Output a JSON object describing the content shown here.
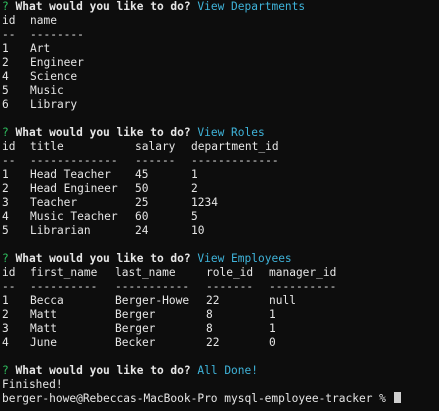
{
  "prompt_mark": "?",
  "question": "What would you like to do?",
  "departments": {
    "answer": "View Departments",
    "headers": [
      "id",
      "name"
    ],
    "rules": [
      "--",
      "--------"
    ],
    "rows": [
      [
        "1",
        "Art"
      ],
      [
        "2",
        "Engineer"
      ],
      [
        "4",
        "Science"
      ],
      [
        "5",
        "Music"
      ],
      [
        "6",
        "Library"
      ]
    ]
  },
  "roles": {
    "answer": "View Roles",
    "headers": [
      "id",
      "title",
      "salary",
      "department_id"
    ],
    "rules": [
      "--",
      "-------------",
      "------",
      "-------------"
    ],
    "rows": [
      [
        "1",
        "Head Teacher",
        "45",
        "1"
      ],
      [
        "2",
        "Head Engineer",
        "50",
        "2"
      ],
      [
        "3",
        "Teacher",
        "25",
        "1234"
      ],
      [
        "4",
        "Music Teacher",
        "60",
        "5"
      ],
      [
        "5",
        "Librarian",
        "24",
        "10"
      ]
    ]
  },
  "employees": {
    "answer": "View Employees",
    "headers": [
      "id",
      "first_name",
      "last_name",
      "role_id",
      "manager_id"
    ],
    "rules": [
      "--",
      "----------",
      "-----------",
      "-------",
      "----------"
    ],
    "rows": [
      [
        "1",
        "Becca",
        "Berger-Howe",
        "22",
        "null"
      ],
      [
        "2",
        "Matt",
        "Berger",
        "8",
        "1"
      ],
      [
        "3",
        "Matt",
        "Berger",
        "8",
        "1"
      ],
      [
        "4",
        "June",
        "Becker",
        "22",
        "0"
      ]
    ]
  },
  "done": {
    "answer": "All Done!",
    "finished": "Finished!",
    "shell_prompt": "berger-howe@Rebeccas-MacBook-Pro mysql-employee-tracker %"
  },
  "colors": {
    "background": "#0d0d0d",
    "text": "#e6e6e6",
    "prompt_mark": "#2fbf5f",
    "answer": "#3fb3d9"
  }
}
